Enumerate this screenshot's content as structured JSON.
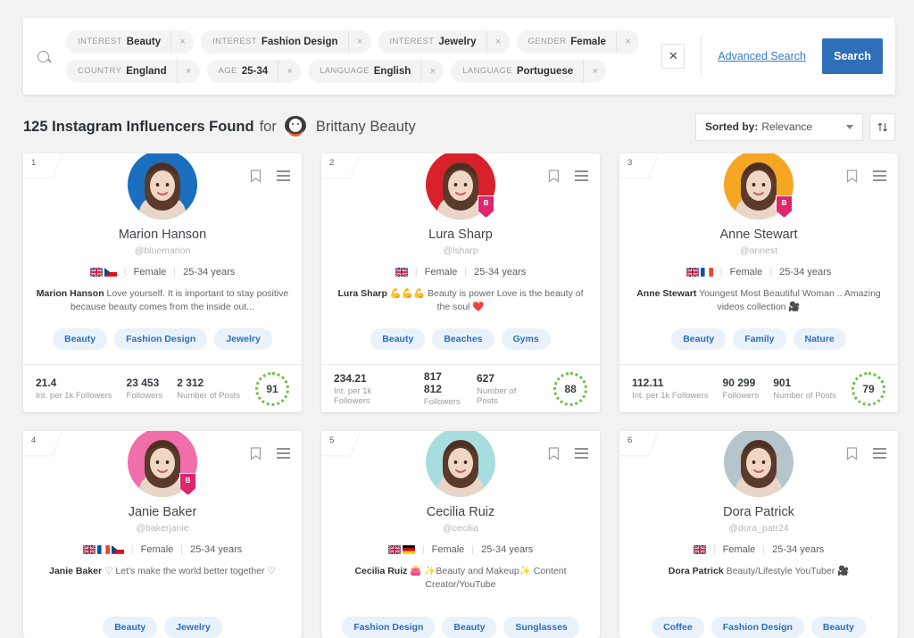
{
  "search": {
    "search_icon": "search-icon",
    "filters": [
      {
        "category": "INTEREST",
        "value": "Beauty",
        "remove": "×"
      },
      {
        "category": "INTEREST",
        "value": "Fashion Design",
        "remove": "×"
      },
      {
        "category": "INTEREST",
        "value": "Jewelry",
        "remove": "×"
      },
      {
        "category": "GENDER",
        "value": "Female",
        "remove": "×"
      },
      {
        "category": "COUNTRY",
        "value": "England",
        "remove": "×"
      },
      {
        "category": "AGE",
        "value": "25-34",
        "remove": "×"
      },
      {
        "category": "LANGUAGE",
        "value": "English",
        "remove": "×"
      },
      {
        "category": "LANGUAGE",
        "value": "Portuguese",
        "remove": "×"
      }
    ],
    "clear_all": "✕",
    "advanced_search": "Advanced Search",
    "search_button": "Search",
    "button_color": "#2f6fb7"
  },
  "results_header": {
    "count_text": "125 Instagram Influencers Found",
    "for_text": "for",
    "brand_name": "Brittany Beauty",
    "brand_logo_icon": "brittany-beauty-logo-icon",
    "sort_label": "Sorted by:",
    "sort_value": "Relevance",
    "sort_direction_icon": "↑↓"
  },
  "cards": [
    {
      "number": "1",
      "name": "Marion Hanson",
      "handle": "@bluemarion",
      "flags": [
        "uk",
        "cz"
      ],
      "gender": "Female",
      "age": "25-34 years",
      "bio_name": "Marion Hanson",
      "bio": "Love yourself. It is important to stay positive because beauty comes from the inside out...",
      "tags": [
        "Beauty",
        "Fashion Design",
        "Jewelry"
      ],
      "verified": false,
      "avatar_bg": "#1b6fbf",
      "stats": [
        {
          "value": "21.4",
          "label": "Int. per 1k Followers"
        },
        {
          "value": "23 453",
          "label": "Followers"
        },
        {
          "value": "2 312",
          "label": "Number of Posts"
        }
      ],
      "score": "91"
    },
    {
      "number": "2",
      "name": "Lura Sharp",
      "handle": "@lsharp",
      "flags": [
        "uk"
      ],
      "gender": "Female",
      "age": "25-34 years",
      "bio_name": "Lura Sharp",
      "bio": "💪💪💪 Beauty is power Love is the beauty of the soul ❤️",
      "tags": [
        "Beauty",
        "Beaches",
        "Gyms"
      ],
      "verified": true,
      "badge_letter": "B",
      "avatar_bg": "#d9212b",
      "stats": [
        {
          "value": "234.21",
          "label": "Int. per 1k Followers"
        },
        {
          "value": "817 812",
          "label": "Followers"
        },
        {
          "value": "627",
          "label": "Number of Posts"
        }
      ],
      "score": "88"
    },
    {
      "number": "3",
      "name": "Anne Stewart",
      "handle": "@annest",
      "flags": [
        "uk",
        "fr"
      ],
      "gender": "Female",
      "age": "25-34 years",
      "bio_name": "Anne Stewart",
      "bio": "Youngest Most Beautiful Woman .. Amazing videos collection 🎥",
      "tags": [
        "Beauty",
        "Family",
        "Nature"
      ],
      "verified": true,
      "badge_letter": "B",
      "avatar_bg": "#f5a623",
      "stats": [
        {
          "value": "112.11",
          "label": "Int. per 1k Followers"
        },
        {
          "value": "90 299",
          "label": "Followers"
        },
        {
          "value": "901",
          "label": "Number of Posts"
        }
      ],
      "score": "79"
    },
    {
      "number": "4",
      "name": "Janie Baker",
      "handle": "@bakerjanie",
      "flags": [
        "uk",
        "fr",
        "cz"
      ],
      "gender": "Female",
      "age": "25-34 years",
      "bio_name": "Janie Baker",
      "bio": "♡ Let's make the world better together ♡",
      "tags": [
        "Beauty",
        "Jewelry"
      ],
      "verified": true,
      "badge_letter": "B",
      "avatar_bg": "#f06ea9"
    },
    {
      "number": "5",
      "name": "Cecilia Ruiz",
      "handle": "@cecilia",
      "flags": [
        "uk",
        "de"
      ],
      "gender": "Female",
      "age": "25-34 years",
      "bio_name": "Cecilia Ruiz",
      "bio": "👛 ✨Beauty and Makeup✨ Content Creator/YouTube",
      "tags": [
        "Fashion Design",
        "Beauty",
        "Sunglasses"
      ],
      "verified": false,
      "avatar_bg": "#a8dde0"
    },
    {
      "number": "6",
      "name": "Dora Patrick",
      "handle": "@dora_patr24",
      "flags": [
        "uk"
      ],
      "gender": "Female",
      "age": "25-34 years",
      "bio_name": "Dora Patrick",
      "bio": "Beauty/Lifestyle YouTuber 🎥",
      "tags": [
        "Coffee",
        "Fashion Design",
        "Beauty"
      ],
      "verified": false,
      "avatar_bg": "#b6c4cc"
    }
  ],
  "icons": {
    "bookmark": "bookmark-icon",
    "menu": "hamburger-menu-icon"
  }
}
